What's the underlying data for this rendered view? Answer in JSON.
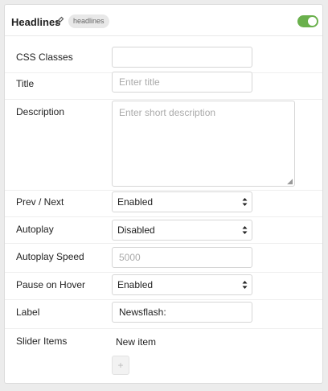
{
  "header": {
    "title": "Headlines",
    "badge": "headlines",
    "enabled": true
  },
  "fields": {
    "css_classes": {
      "label": "CSS Classes",
      "value": ""
    },
    "title": {
      "label": "Title",
      "placeholder": "Enter title"
    },
    "description": {
      "label": "Description",
      "placeholder": "Enter short description"
    },
    "prev_next": {
      "label": "Prev / Next",
      "value": "Enabled"
    },
    "autoplay": {
      "label": "Autoplay",
      "value": "Disabled"
    },
    "autoplay_speed": {
      "label": "Autoplay Speed",
      "placeholder": "5000"
    },
    "pause_on_hover": {
      "label": "Pause on Hover",
      "value": "Enabled"
    },
    "label": {
      "label": "Label",
      "value": "Newsflash:"
    },
    "slider_items": {
      "label": "Slider Items",
      "new_item": "New item",
      "add_label": "+"
    }
  },
  "colors": {
    "toggle_on": "#6ab04c",
    "border": "#d6d6d6",
    "placeholder": "#aaaaaa"
  }
}
